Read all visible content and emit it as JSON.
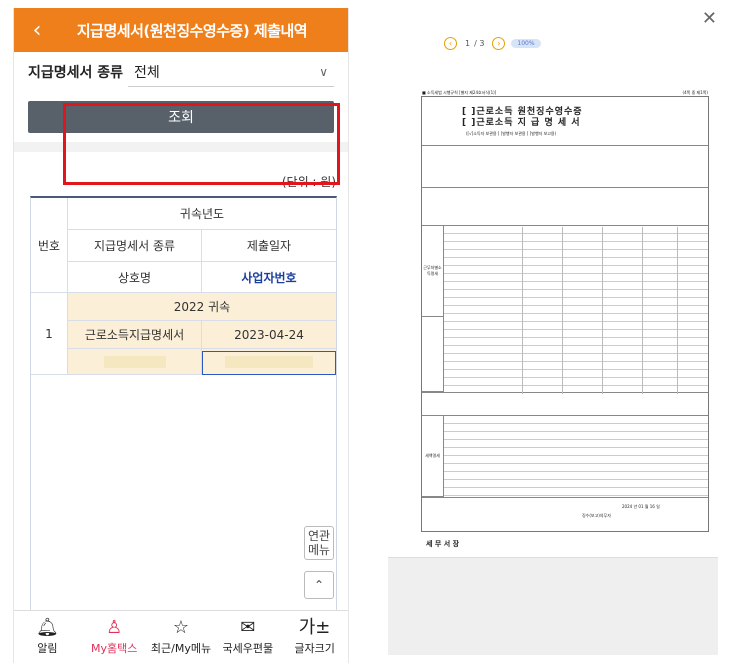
{
  "app": {
    "title": "지급명세서(원천징수영수증) 제출내역",
    "back_icon": "chevron-left-icon"
  },
  "filter": {
    "label": "지급명세서 종류",
    "selected": "전체"
  },
  "search_button": "조회",
  "unit_label": "(단위 : 원)",
  "table": {
    "headers": {
      "number": "번호",
      "year": "귀속년도",
      "type": "지급명세서 종류",
      "submit_date": "제출일자",
      "company": "상호명",
      "biz_no": "사업자번호"
    },
    "rows": [
      {
        "number": "1",
        "year": "2022 귀속",
        "type": "근로소득지급명세서",
        "submit_date": "2023-04-24"
      }
    ]
  },
  "float_buttons": {
    "related_menu": "연관\n메뉴",
    "top": "⌃"
  },
  "bottom_nav": [
    {
      "label": "알림",
      "icon": "bell-icon",
      "glyph": "🔔︎"
    },
    {
      "label": "My홈택스",
      "icon": "user-icon",
      "glyph": "♙"
    },
    {
      "label": "최근/My메뉴",
      "icon": "star-icon",
      "glyph": "☆"
    },
    {
      "label": "국세우편물",
      "icon": "mail-icon",
      "glyph": "✉"
    },
    {
      "label": "글자크기",
      "icon": "font-size-icon",
      "glyph": "가±"
    }
  ],
  "viewer": {
    "close": "✕",
    "page_current": "1",
    "page_total": "/ 3",
    "zoom": "100%",
    "doc": {
      "header_left": "■ 소득세법 시행규칙 [별지 제24호서식(1)]",
      "header_right": "(4쪽 중 제1쪽)",
      "title_line1": "[  ]근로소득 원천징수영수증",
      "title_line2": "[  ]근로소득 지 급 명 세 서",
      "subtitle": "([√]소득자 보관용  [ ]발행자 보관용  [ ]발행자 보고용)",
      "section_income": "근무처별소득명세",
      "section_tax": "세액명세",
      "date": "2024 년    01 월    16 일",
      "footer": "징수(보고)의무자",
      "office": "세 무 서 장"
    }
  }
}
